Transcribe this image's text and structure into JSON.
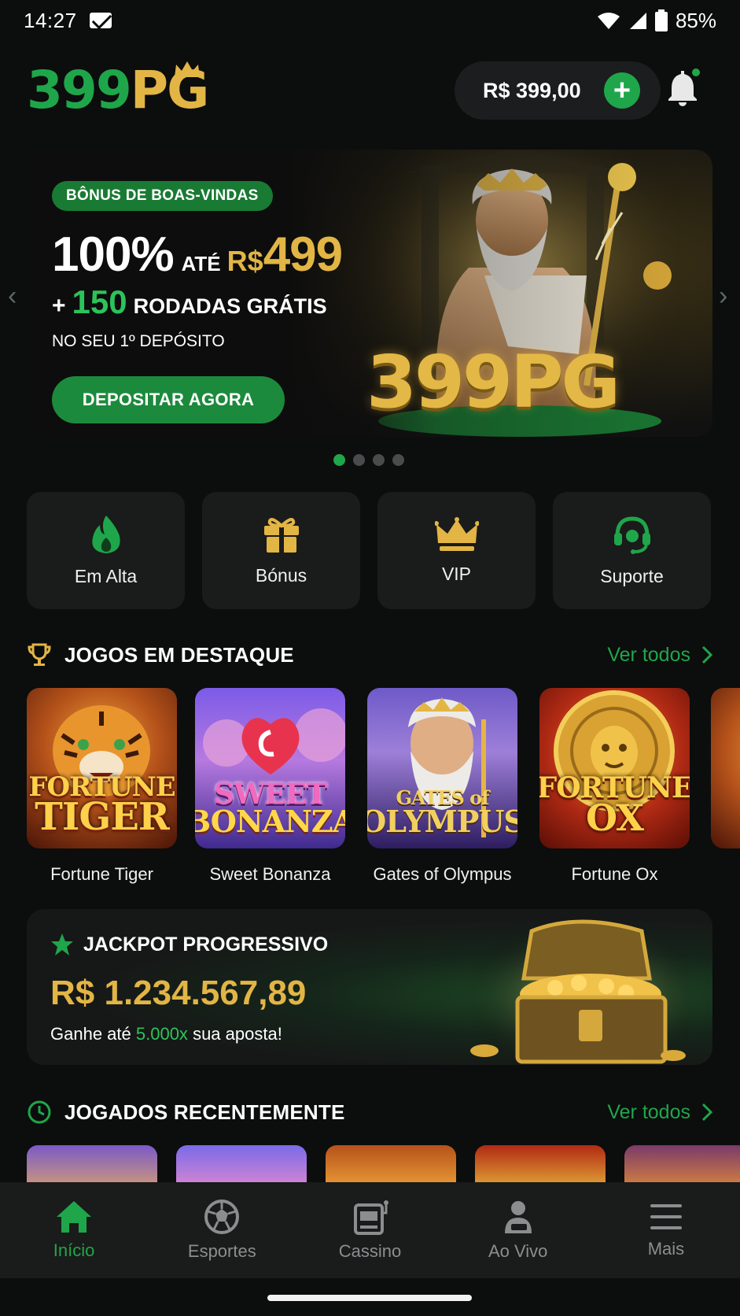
{
  "status_bar": {
    "time": "14:27",
    "battery": "85%"
  },
  "header": {
    "logo_green": "399",
    "logo_gold": "PG",
    "balance": "R$ 399,00",
    "add_symbol": "+"
  },
  "banner": {
    "tag": "BÔNUS DE BOAS-VINDAS",
    "percent": "100%",
    "upto": "ATÉ",
    "currency": "R$",
    "amount": "499",
    "plus": "+",
    "spins_count": "150",
    "spins_label": "RODADAS GRÁTIS",
    "condition": "NO SEU 1º DEPÓSITO",
    "cta": "DEPOSITAR AGORA",
    "art_word": "399PG",
    "slides_total": 4,
    "active_slide": 1
  },
  "quick_links": [
    {
      "label": "Em Alta",
      "icon": "flame-icon"
    },
    {
      "label": "Bónus",
      "icon": "gift-icon"
    },
    {
      "label": "VIP",
      "icon": "crown-icon"
    },
    {
      "label": "Suporte",
      "icon": "headset-icon"
    }
  ],
  "featured": {
    "title": "JOGOS EM DESTAQUE",
    "see_all": "Ver todos",
    "games": [
      {
        "name": "Fortune Tiger",
        "art_line1": "FORTUNE",
        "art_line2": "TIGER"
      },
      {
        "name": "Sweet Bonanza",
        "art_line1": "SWEET",
        "art_line2": "BONANZA"
      },
      {
        "name": "Gates of Olympus",
        "art_line1": "GATES of",
        "art_line2": "OLYMPUS"
      },
      {
        "name": "Fortune Ox",
        "art_line1": "FORTUNE",
        "art_line2": "OX"
      }
    ]
  },
  "jackpot": {
    "title": "JACKPOT PROGRESSIVO",
    "amount": "R$ 1.234.567,89",
    "sub_prefix": "Ganhe até",
    "sub_highlight": "5.000x",
    "sub_suffix": "sua aposta!"
  },
  "recent": {
    "title": "JOGADOS RECENTEMENTE",
    "see_all": "Ver todos"
  },
  "nav": [
    {
      "label": "Início",
      "icon": "home-icon",
      "active": true
    },
    {
      "label": "Esportes",
      "icon": "soccer-ball-icon",
      "active": false
    },
    {
      "label": "Cassino",
      "icon": "slot-machine-icon",
      "active": false
    },
    {
      "label": "Ao Vivo",
      "icon": "live-dealer-icon",
      "active": false
    },
    {
      "label": "Mais",
      "icon": "menu-icon",
      "active": false
    }
  ],
  "colors": {
    "accent_green": "#1fa64a",
    "gold": "#e2b545",
    "background": "#0c0d0d",
    "card": "#1a1b1b"
  }
}
